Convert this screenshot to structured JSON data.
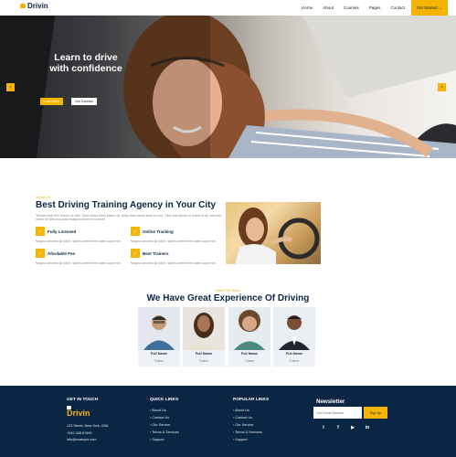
{
  "nav": {
    "brand": "Drivin",
    "links": [
      "Home",
      "About",
      "Courses",
      "Pages",
      "Contact"
    ],
    "cta": "Get Started →"
  },
  "hero": {
    "title_line1": "Learn to drive",
    "title_line2": "with confidence",
    "btn_primary": "Learn More",
    "btn_secondary": "Our Courses",
    "arrow_prev": "‹",
    "arrow_next": "›"
  },
  "about": {
    "subtitle": "About Us",
    "title": "Best Driving Training Agency in Your City",
    "paragraph": "Tempor erat elitr rebum at clita. Diam dolor diam ipsum sit. Aliqu diam amet diam et eos. Clita erat ipsum et lorem et sit, sed stet lorem sit clita duo justo magna dolore erat amet",
    "features": [
      {
        "title": "Fully Licensed",
        "desc": "Magna sea eos sit dolor, ipsum amet lorem diam dolor eos"
      },
      {
        "title": "Online Tracking",
        "desc": "Magna sea eos sit dolor, ipsum amet lorem diam dolor eos"
      },
      {
        "title": "Afordable Fee",
        "desc": "Magna sea eos sit dolor, ipsum amet lorem diam dolor eos"
      },
      {
        "title": "Best Trainers",
        "desc": "Magna sea eos sit dolor, ipsum amet lorem diam dolor eos"
      }
    ],
    "check_glyph": "✓"
  },
  "team": {
    "subtitle": "Meet The Team",
    "title": "We Have Great Experience Of Driving",
    "members": [
      {
        "name": "Full Name",
        "role": "Trainer"
      },
      {
        "name": "Full Name",
        "role": "Trainer"
      },
      {
        "name": "Full Name",
        "role": "Trainer"
      },
      {
        "name": "Full Name",
        "role": "Trainer"
      }
    ]
  },
  "footer": {
    "get_in_touch": "GET IN TOUCH",
    "brand": "Drivin",
    "address": "123 Street, New York, USA",
    "phone": "+012 345 67890",
    "email": "info@example.com",
    "quick_links_title": "QUICK LINKS",
    "quick_links": [
      "About Us",
      "Contact Us",
      "Our Service",
      "Terms & Services",
      "Support"
    ],
    "popular_links_title": "POPULAR LINKS",
    "popular_links": [
      "About Us",
      "Contact Us",
      "Our Service",
      "Terms & Services",
      "Support"
    ],
    "link_prefix": "›",
    "newsletter_title": "Newsletter",
    "newsletter_placeholder": "Your Email Address",
    "newsletter_button": "Sign Up",
    "social": [
      "t",
      "f",
      "▶",
      "in"
    ]
  },
  "colors": {
    "accent": "#f5b400",
    "navy": "#0b2545"
  }
}
